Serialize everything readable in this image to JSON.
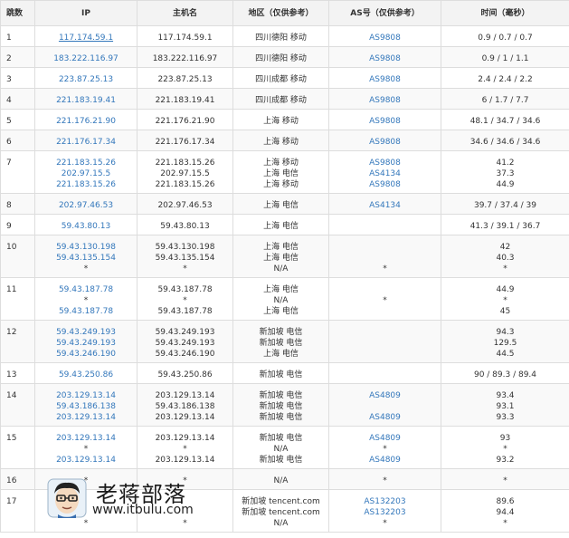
{
  "headers": [
    "跳数",
    "IP",
    "主机名",
    "地区（仅供参考）",
    "AS号（仅供参考）",
    "时间（毫秒）"
  ],
  "rows": [
    {
      "hop": "1",
      "ip": [
        "117.174.59.1"
      ],
      "host": [
        "117.174.59.1"
      ],
      "region": [
        "四川德阳 移动"
      ],
      "as": [
        "AS9808"
      ],
      "time": [
        "0.9 / 0.7 / 0.7"
      ]
    },
    {
      "hop": "2",
      "ip": [
        "183.222.116.97"
      ],
      "host": [
        "183.222.116.97"
      ],
      "region": [
        "四川德阳 移动"
      ],
      "as": [
        "AS9808"
      ],
      "time": [
        "0.9 / 1 / 1.1"
      ]
    },
    {
      "hop": "3",
      "ip": [
        "223.87.25.13"
      ],
      "host": [
        "223.87.25.13"
      ],
      "region": [
        "四川成都 移动"
      ],
      "as": [
        "AS9808"
      ],
      "time": [
        "2.4 / 2.4 / 2.2"
      ]
    },
    {
      "hop": "4",
      "ip": [
        "221.183.19.41"
      ],
      "host": [
        "221.183.19.41"
      ],
      "region": [
        "四川成都 移动"
      ],
      "as": [
        "AS9808"
      ],
      "time": [
        "6 / 1.7 / 7.7"
      ]
    },
    {
      "hop": "5",
      "ip": [
        "221.176.21.90"
      ],
      "host": [
        "221.176.21.90"
      ],
      "region": [
        "上海 移动"
      ],
      "as": [
        "AS9808"
      ],
      "time": [
        "48.1 / 34.7 / 34.6"
      ]
    },
    {
      "hop": "6",
      "ip": [
        "221.176.17.34"
      ],
      "host": [
        "221.176.17.34"
      ],
      "region": [
        "上海 移动"
      ],
      "as": [
        "AS9808"
      ],
      "time": [
        "34.6 / 34.6 / 34.6"
      ]
    },
    {
      "hop": "7",
      "ip": [
        "221.183.15.26",
        "202.97.15.5",
        "221.183.15.26"
      ],
      "host": [
        "221.183.15.26",
        "202.97.15.5",
        "221.183.15.26"
      ],
      "region": [
        "上海 移动",
        "上海 电信",
        "上海 移动"
      ],
      "as": [
        "AS9808",
        "AS4134",
        "AS9808"
      ],
      "time": [
        "41.2",
        "37.3",
        "44.9"
      ]
    },
    {
      "hop": "8",
      "ip": [
        "202.97.46.53"
      ],
      "host": [
        "202.97.46.53"
      ],
      "region": [
        "上海 电信"
      ],
      "as": [
        "AS4134"
      ],
      "time": [
        "39.7 / 37.4 / 39"
      ]
    },
    {
      "hop": "9",
      "ip": [
        "59.43.80.13"
      ],
      "host": [
        "59.43.80.13"
      ],
      "region": [
        "上海 电信"
      ],
      "as": [
        ""
      ],
      "time": [
        "41.3 / 39.1 / 36.7"
      ]
    },
    {
      "hop": "10",
      "ip": [
        "59.43.130.198",
        "59.43.135.154",
        "*"
      ],
      "host": [
        "59.43.130.198",
        "59.43.135.154",
        "*"
      ],
      "region": [
        "上海 电信",
        "上海 电信",
        "N/A"
      ],
      "as": [
        "",
        "",
        "*"
      ],
      "time": [
        "42",
        "40.3",
        "*"
      ]
    },
    {
      "hop": "11",
      "ip": [
        "59.43.187.78",
        "*",
        "59.43.187.78"
      ],
      "host": [
        "59.43.187.78",
        "*",
        "59.43.187.78"
      ],
      "region": [
        "上海 电信",
        "N/A",
        "上海 电信"
      ],
      "as": [
        "",
        "*",
        ""
      ],
      "time": [
        "44.9",
        "*",
        "45"
      ]
    },
    {
      "hop": "12",
      "ip": [
        "59.43.249.193",
        "59.43.249.193",
        "59.43.246.190"
      ],
      "host": [
        "59.43.249.193",
        "59.43.249.193",
        "59.43.246.190"
      ],
      "region": [
        "新加坡 电信",
        "新加坡 电信",
        "上海 电信"
      ],
      "as": [
        "",
        "",
        ""
      ],
      "time": [
        "94.3",
        "129.5",
        "44.5"
      ]
    },
    {
      "hop": "13",
      "ip": [
        "59.43.250.86"
      ],
      "host": [
        "59.43.250.86"
      ],
      "region": [
        "新加坡 电信"
      ],
      "as": [
        ""
      ],
      "time": [
        "90 / 89.3 / 89.4"
      ]
    },
    {
      "hop": "14",
      "ip": [
        "203.129.13.14",
        "59.43.186.138",
        "203.129.13.14"
      ],
      "host": [
        "203.129.13.14",
        "59.43.186.138",
        "203.129.13.14"
      ],
      "region": [
        "新加坡 电信",
        "新加坡 电信",
        "新加坡 电信"
      ],
      "as": [
        "AS4809",
        "",
        "AS4809"
      ],
      "time": [
        "93.4",
        "93.1",
        "93.3"
      ]
    },
    {
      "hop": "15",
      "ip": [
        "203.129.13.14",
        "*",
        "203.129.13.14"
      ],
      "host": [
        "203.129.13.14",
        "*",
        "203.129.13.14"
      ],
      "region": [
        "新加坡 电信",
        "N/A",
        "新加坡 电信"
      ],
      "as": [
        "AS4809",
        "*",
        "AS4809"
      ],
      "time": [
        "93",
        "*",
        "93.2"
      ]
    },
    {
      "hop": "16",
      "ip": [
        "*"
      ],
      "host": [
        "*"
      ],
      "region": [
        "N/A"
      ],
      "as": [
        "*"
      ],
      "time": [
        "*"
      ]
    },
    {
      "hop": "17",
      "ip": [
        "",
        "",
        "*"
      ],
      "host": [
        "",
        "",
        "*"
      ],
      "region": [
        "新加坡 tencent.com",
        "新加坡 tencent.com",
        "N/A"
      ],
      "as": [
        "AS132203",
        "AS132203",
        "*"
      ],
      "time": [
        "89.6",
        "94.4",
        "*"
      ]
    }
  ],
  "watermark": {
    "title": "老蒋部落",
    "url": "www.itbulu.com"
  },
  "colors": {
    "link": "#3377bb",
    "border": "#dddddd",
    "header_bg": "#f3f3f3"
  }
}
